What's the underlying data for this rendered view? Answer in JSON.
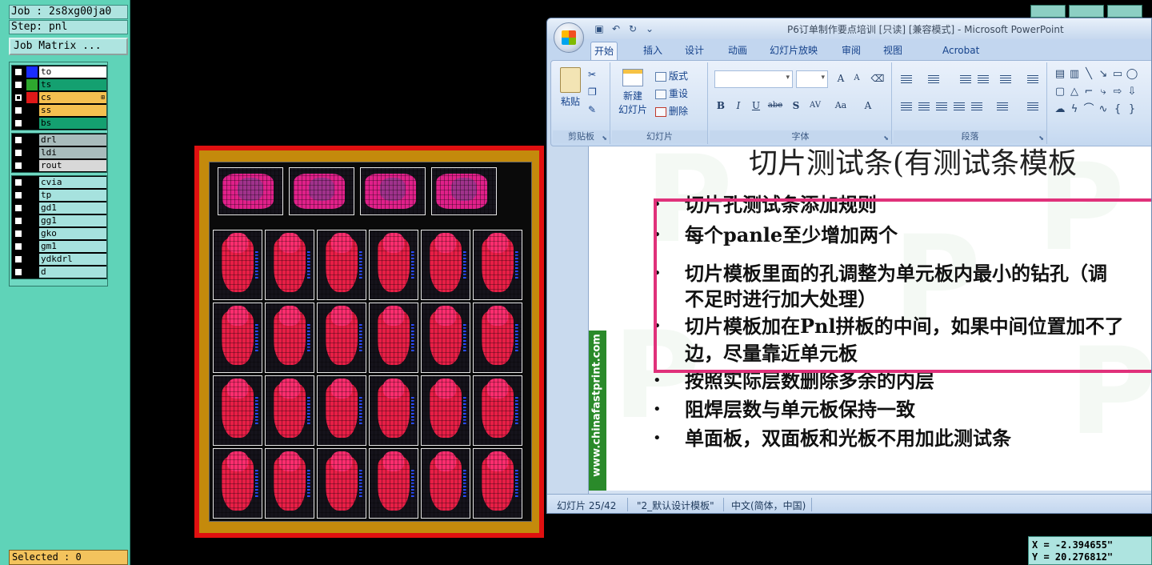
{
  "genesis": {
    "job_label": "Job : 2s8xg00ja0",
    "step_label": "Step: pnl",
    "job_matrix_label": "Job Matrix ...",
    "selected_label": "Selected : 0",
    "coord_x": "X = -2.394655\"",
    "coord_y": "Y = 20.276812\"",
    "layer_groups": [
      {
        "layers": [
          {
            "name": "to",
            "color": "#1a2cff",
            "bg": "#ffffff",
            "checked": false
          },
          {
            "name": "ts",
            "color": "#2ea82e",
            "bg": "#14a070",
            "checked": false
          },
          {
            "name": "cs",
            "color": "#e01818",
            "bg": "#f5c050",
            "checked": true,
            "mark": "⊞"
          },
          {
            "name": "ss",
            "color": "#000000",
            "bg": "#f5c050",
            "checked": false
          },
          {
            "name": "bs",
            "color": "#000000",
            "bg": "#14a070",
            "checked": false
          }
        ]
      },
      {
        "layers": [
          {
            "name": "drl",
            "color": "#000000",
            "bg": "#a8bcbc",
            "checked": false
          },
          {
            "name": "ldi",
            "color": "#000000",
            "bg": "#a8bcbc",
            "checked": false
          },
          {
            "name": "rout",
            "color": "#000000",
            "bg": "#d8d8d8",
            "checked": false
          }
        ]
      },
      {
        "layers": [
          {
            "name": "cvia",
            "color": "#000000",
            "bg": "#a6e2de",
            "checked": false
          },
          {
            "name": "tp",
            "color": "#000000",
            "bg": "#a6e2de",
            "checked": false
          },
          {
            "name": "gd1",
            "color": "#000000",
            "bg": "#a6e2de",
            "checked": false
          },
          {
            "name": "gg1",
            "color": "#000000",
            "bg": "#a6e2de",
            "checked": false
          },
          {
            "name": "gko",
            "color": "#000000",
            "bg": "#a6e2de",
            "checked": false
          },
          {
            "name": "gm1",
            "color": "#000000",
            "bg": "#a6e2de",
            "checked": false
          },
          {
            "name": "ydkdrl",
            "color": "#000000",
            "bg": "#a6e2de",
            "checked": false
          },
          {
            "name": "d",
            "color": "#000000",
            "bg": "#a6e2de",
            "checked": false
          }
        ]
      }
    ]
  },
  "ppt": {
    "title": "P6订单制作要点培训 [只读] [兼容模式] - Microsoft PowerPoint",
    "tabs": [
      "开始",
      "插入",
      "设计",
      "动画",
      "幻灯片放映",
      "审阅",
      "视图",
      "Acrobat"
    ],
    "ribbon": {
      "paste_label": "粘贴",
      "clipboard_group": "剪贴板",
      "new_slide_label_1": "新建",
      "new_slide_label_2": "幻灯片",
      "layout_label": "版式",
      "reset_label": "重设",
      "delete_label": "删除",
      "slides_group": "幻灯片",
      "font_group": "字体",
      "paragraph_group": "段落"
    },
    "slide": {
      "title": "切片测试条(有测试条模板",
      "sidebar_text": "www.chinafastprint.com",
      "watermark": "P",
      "bullets": [
        {
          "text": "切片孔测试条添加规则"
        },
        {
          "text": "每个panle至少增加两个"
        },
        {
          "text": "切片模板里面的孔调整为单元板内最小的钻孔（调"
        },
        {
          "text": "不足时进行加大处理）"
        },
        {
          "text": "切片模板加在Pnl拼板的中间，如果中间位置加不了"
        },
        {
          "text": "边，尽量靠近单元板"
        },
        {
          "text": "按照实际层数删除多余的内层"
        },
        {
          "text": "阻焊层数与单元板保持一致"
        },
        {
          "text": "单面板，双面板和光板不用加此测试条"
        }
      ],
      "bullet_char": "•"
    },
    "status": {
      "slide_num": "幻灯片 25/42",
      "template": "\"2_默认设计模板\"",
      "language": "中文(简体，中国)"
    }
  }
}
